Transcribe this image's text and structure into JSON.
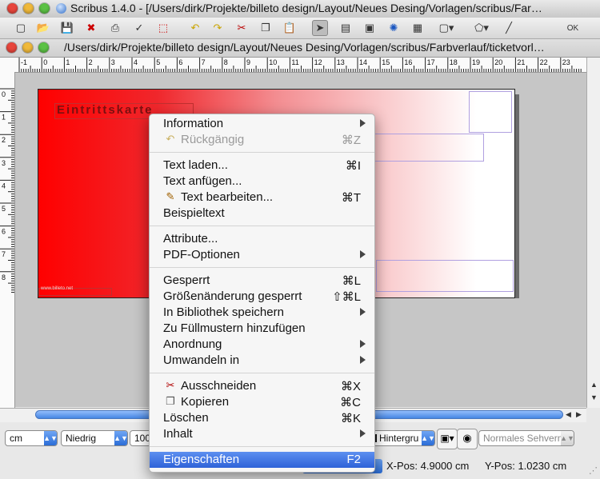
{
  "window": {
    "title": "Scribus 1.4.0 - [/Users/dirk/Projekte/billeto design/Layout/Neues Desing/Vorlagen/scribus/Far…",
    "doc_path": "/Users/dirk/Projekte/billeto design/Layout/Neues Desing/Vorlagen/scribus/Farbverlauf/ticketvorl…"
  },
  "ruler": {
    "h_ticks": [
      "-1",
      "0",
      "1",
      "2",
      "3",
      "4",
      "5",
      "6",
      "7",
      "8",
      "9",
      "10",
      "11",
      "12",
      "13",
      "14",
      "15",
      "16",
      "17",
      "18",
      "19",
      "20",
      "21",
      "22",
      "23"
    ],
    "v_ticks": [
      "0",
      "1",
      "2",
      "3",
      "4",
      "5",
      "6",
      "7",
      "8"
    ]
  },
  "document": {
    "heading": "Eintrittskarte",
    "footer_url": "www.billeto.net"
  },
  "statusbar": {
    "unit": "cm",
    "quality": "Niedrig",
    "zoom": "100",
    "layer": "Hintergru",
    "view": "Normales Sehvern",
    "xpos_label": "X-Pos:",
    "xpos_value": "4.9000 cm",
    "ypos_label": "Y-Pos:",
    "ypos_value": "1.0230 cm"
  },
  "menu": {
    "items": [
      {
        "label": "Information",
        "shortcut": "",
        "submenu": true
      },
      {
        "label": "Rückgängig",
        "shortcut": "⌘Z",
        "icon": "undo-icon",
        "disabled": true
      },
      {
        "label": "Text laden...",
        "shortcut": "⌘I"
      },
      {
        "label": "Text anfügen...",
        "shortcut": ""
      },
      {
        "label": "Text bearbeiten...",
        "shortcut": "⌘T",
        "icon": "edit-text-icon"
      },
      {
        "label": "Beispieltext",
        "shortcut": ""
      },
      {
        "label": "Attribute...",
        "shortcut": ""
      },
      {
        "label": "PDF-Optionen",
        "shortcut": "",
        "submenu": true
      },
      {
        "label": "Gesperrt",
        "shortcut": "⌘L"
      },
      {
        "label": "Größenänderung gesperrt",
        "shortcut": "⇧⌘L"
      },
      {
        "label": "In Bibliothek speichern",
        "shortcut": "",
        "submenu": true
      },
      {
        "label": "Zu Füllmustern hinzufügen",
        "shortcut": ""
      },
      {
        "label": "Anordnung",
        "shortcut": "",
        "submenu": true
      },
      {
        "label": "Umwandeln in",
        "shortcut": "",
        "submenu": true
      },
      {
        "label": "Ausschneiden",
        "shortcut": "⌘X",
        "icon": "scissors-icon"
      },
      {
        "label": "Kopieren",
        "shortcut": "⌘C",
        "icon": "copy-icon"
      },
      {
        "label": "Löschen",
        "shortcut": "⌘K"
      },
      {
        "label": "Inhalt",
        "shortcut": "",
        "submenu": true
      },
      {
        "label": "Eigenschaften",
        "shortcut": "F2",
        "highlighted": true
      }
    ]
  },
  "colors": {
    "accent": "#2e62d8",
    "page_red": "#ff0000"
  }
}
